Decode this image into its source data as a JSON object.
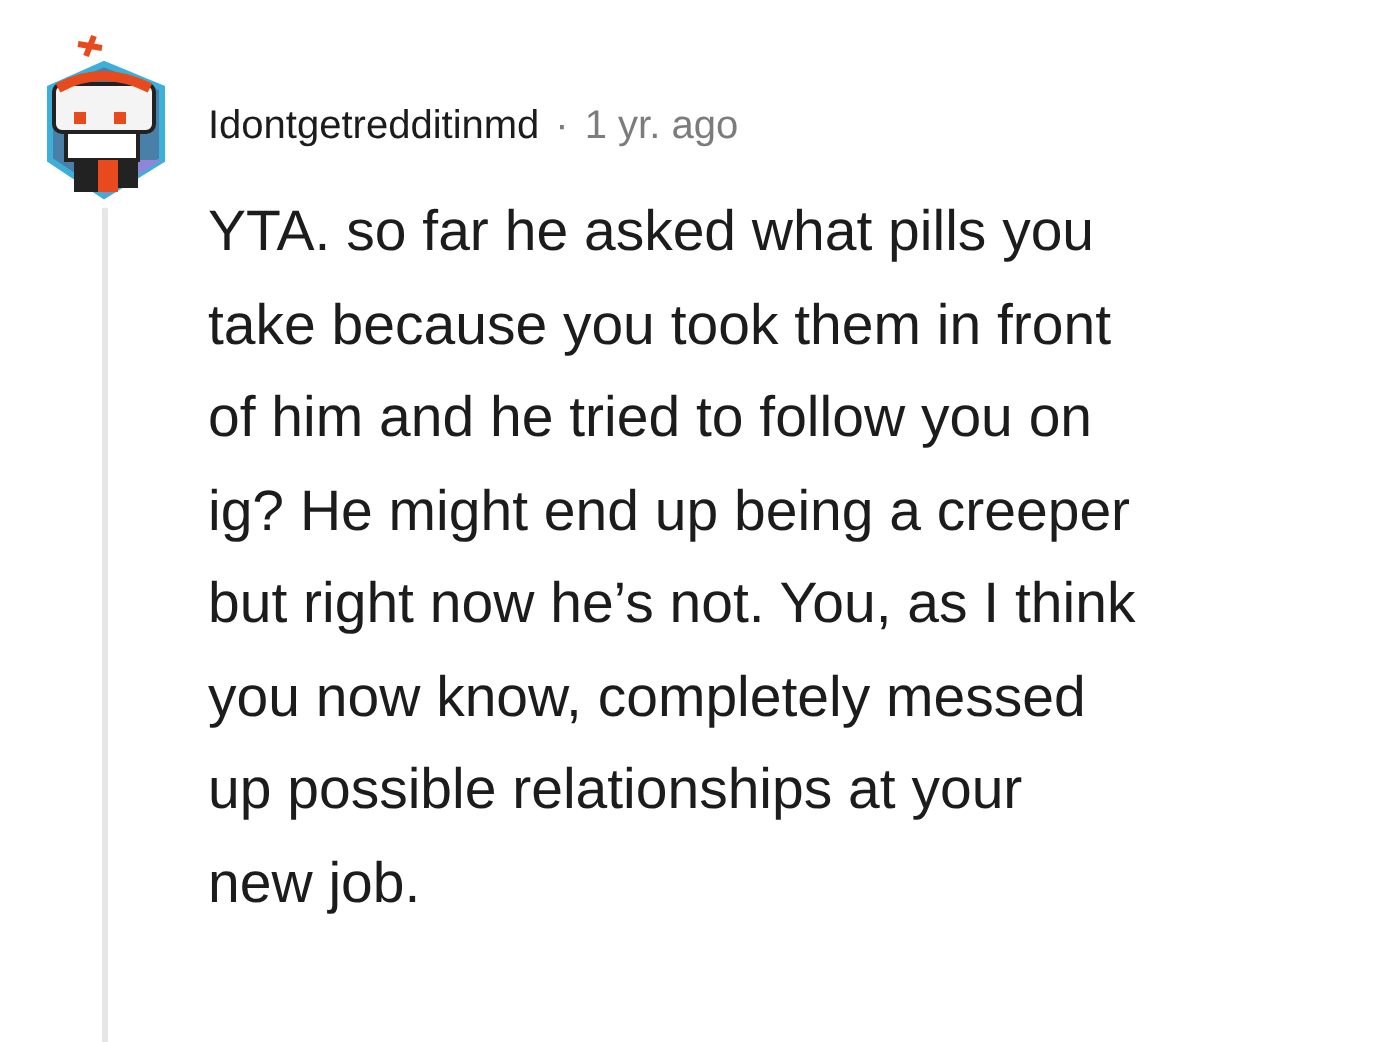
{
  "comment": {
    "author": "Idontgetredditinmd",
    "separator": "·",
    "time": "1 yr. ago",
    "body_lines": [
      "YTA. so far he asked what pills you",
      "take because you took them in front",
      "of him and he tried to follow you on",
      "ig? He might end up being a creeper",
      "but right now he’s not. You, as I think",
      "you now know, completely messed",
      "up possible relationships at your",
      "new job."
    ]
  }
}
